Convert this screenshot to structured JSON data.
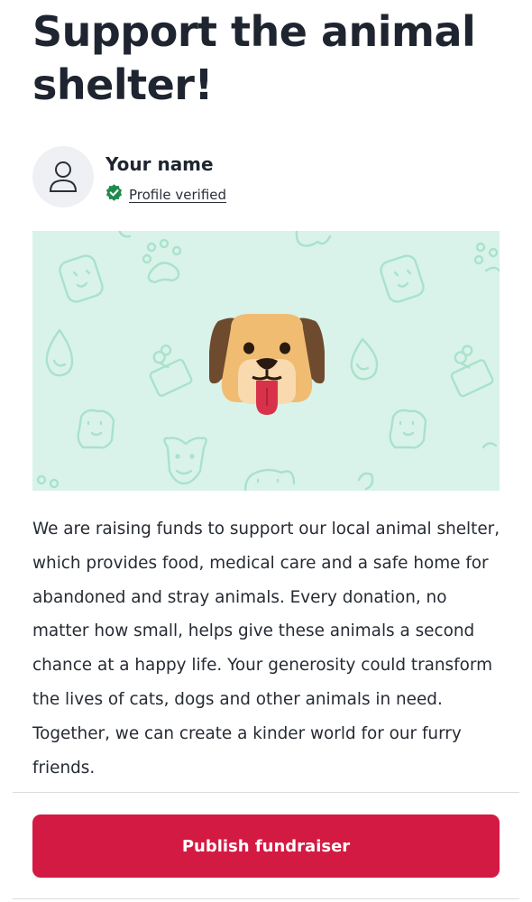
{
  "page": {
    "title": "Support the animal shelter!"
  },
  "organizer": {
    "name": "Your name",
    "verified_label": "Profile verified",
    "avatar_icon": "user-icon",
    "verified_icon": "check-badge-icon"
  },
  "hero": {
    "illustration": "dog-face-icon",
    "background_pattern": "pet-doodle-pattern"
  },
  "description": "We are raising funds to support our local animal shelter, which provides food, medical care and a safe home for abandoned and stray animals. Every donation, no matter how small, helps give these animals a second chance at a happy life. Your generosity could transform the lives of cats, dogs and other animals in need. Together, we can create a kinder world for our furry friends.",
  "actions": {
    "publish_label": "Publish fundraiser"
  },
  "colors": {
    "primary": "#d31a42",
    "hero_bg": "#d9f3ea",
    "verified_green": "#1f8a4c",
    "heading": "#1f2530"
  }
}
